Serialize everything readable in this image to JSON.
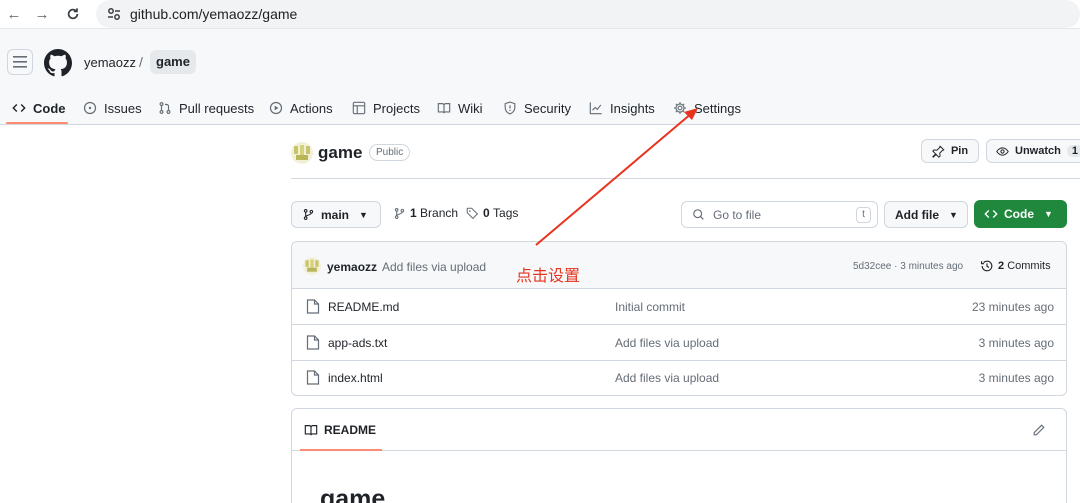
{
  "browser": {
    "url": "github.com/yemaozz/game"
  },
  "header": {
    "owner": "yemaozz",
    "separator": "/",
    "repo": "game"
  },
  "tabs": [
    {
      "label": "Code",
      "icon": "code-icon"
    },
    {
      "label": "Issues",
      "icon": "issue-icon"
    },
    {
      "label": "Pull requests",
      "icon": "pull-request-icon"
    },
    {
      "label": "Actions",
      "icon": "play-icon"
    },
    {
      "label": "Projects",
      "icon": "table-icon"
    },
    {
      "label": "Wiki",
      "icon": "book-icon"
    },
    {
      "label": "Security",
      "icon": "shield-icon"
    },
    {
      "label": "Insights",
      "icon": "graph-icon"
    },
    {
      "label": "Settings",
      "icon": "gear-icon"
    }
  ],
  "repo": {
    "name": "game",
    "visibility": "Public",
    "pin_label": "Pin",
    "unwatch_label": "Unwatch",
    "watch_count": "1"
  },
  "toolbar": {
    "branch": "main",
    "branches": "1 Branch",
    "branches_count": "1",
    "branches_word": "Branch",
    "tags_count": "0",
    "tags_word": "Tags",
    "goto_placeholder": "Go to file",
    "goto_shortcut": "t",
    "add_file": "Add file",
    "code": "Code"
  },
  "latest_commit": {
    "author": "yemaozz",
    "message": "Add files via upload",
    "meta": "5d32cee · 3 minutes ago",
    "commits": "2 Commits",
    "commits_count": "2",
    "commits_word": "Commits"
  },
  "files": [
    {
      "name": "README.md",
      "commit": "Initial commit",
      "age": "23 minutes ago"
    },
    {
      "name": "app-ads.txt",
      "commit": "Add files via upload",
      "age": "3 minutes ago"
    },
    {
      "name": "index.html",
      "commit": "Add files via upload",
      "age": "3 minutes ago"
    }
  ],
  "readme": {
    "tab": "README",
    "title": "game"
  },
  "annotation": {
    "text": "点击设置",
    "color": "#e8331f"
  },
  "colors": {
    "accent_underline": "#fd8c73",
    "code_button": "#1f883d"
  }
}
